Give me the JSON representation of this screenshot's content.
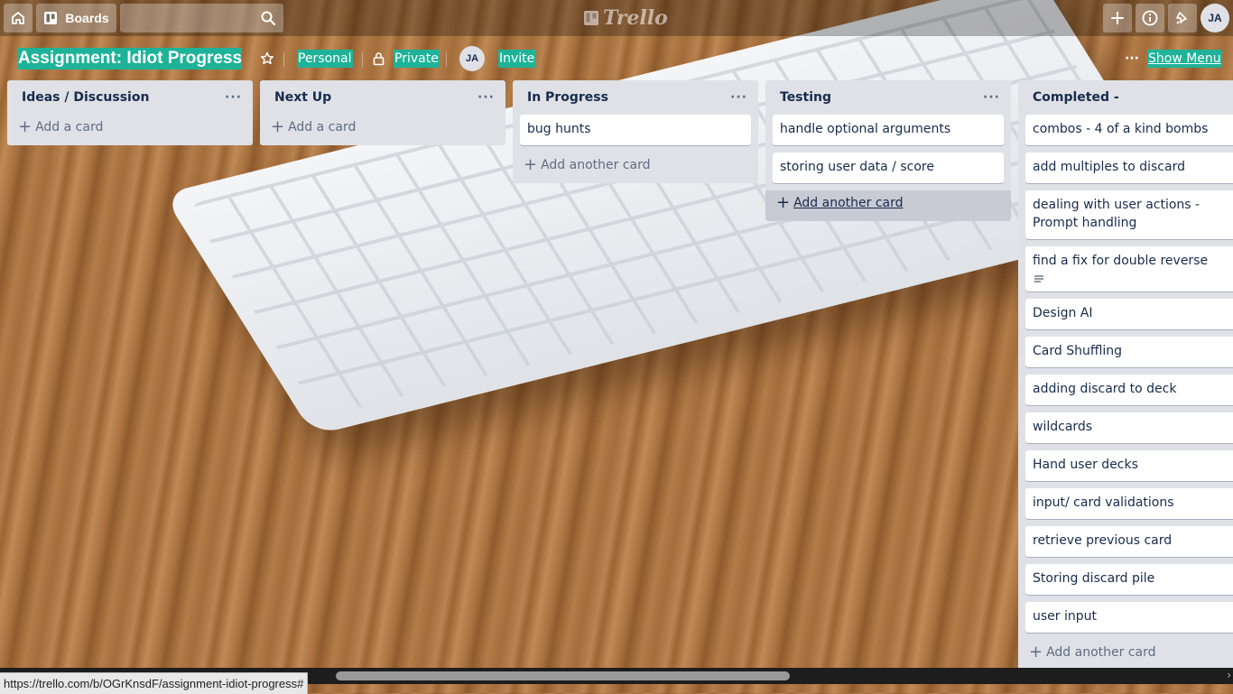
{
  "header": {
    "home_icon": "home-icon",
    "boards_label": "Boards",
    "search_placeholder": "",
    "logo_text": "Trello",
    "avatar_initials": "JA"
  },
  "board": {
    "title": "Assignment: Idiot Progress",
    "team": "Personal",
    "visibility": "Private",
    "member_initials": "JA",
    "invite_label": "Invite",
    "menu_dots": "···",
    "show_menu_label": "Show Menu",
    "highlight_color": "#1eb398"
  },
  "lists": [
    {
      "title": "Ideas / Discussion",
      "cards": [],
      "add_label": "Add a card"
    },
    {
      "title": "Next Up",
      "cards": [],
      "add_label": "Add a card"
    },
    {
      "title": "In Progress",
      "cards": [
        "bug hunts"
      ],
      "add_label": "Add another card"
    },
    {
      "title": "Testing",
      "cards": [
        "handle optional arguments",
        "storing user data / score"
      ],
      "add_label": "Add another card"
    },
    {
      "title": "Completed -",
      "cards": [
        "combos - 4 of a kind bombs",
        "add multiples to discard",
        "dealing with user actions - Prompt handling",
        "find a fix for double reverse",
        "Design AI",
        "Card Shuffling",
        "adding discard to deck",
        "wildcards",
        "Hand user decks",
        "input/ card validations",
        "retrieve previous card",
        "Storing discard pile",
        "user input"
      ],
      "add_label": "Add another card"
    }
  ],
  "status_bar": {
    "url": "https://trello.com/b/OGrKnsdF/assignment-idiot-progress#"
  }
}
